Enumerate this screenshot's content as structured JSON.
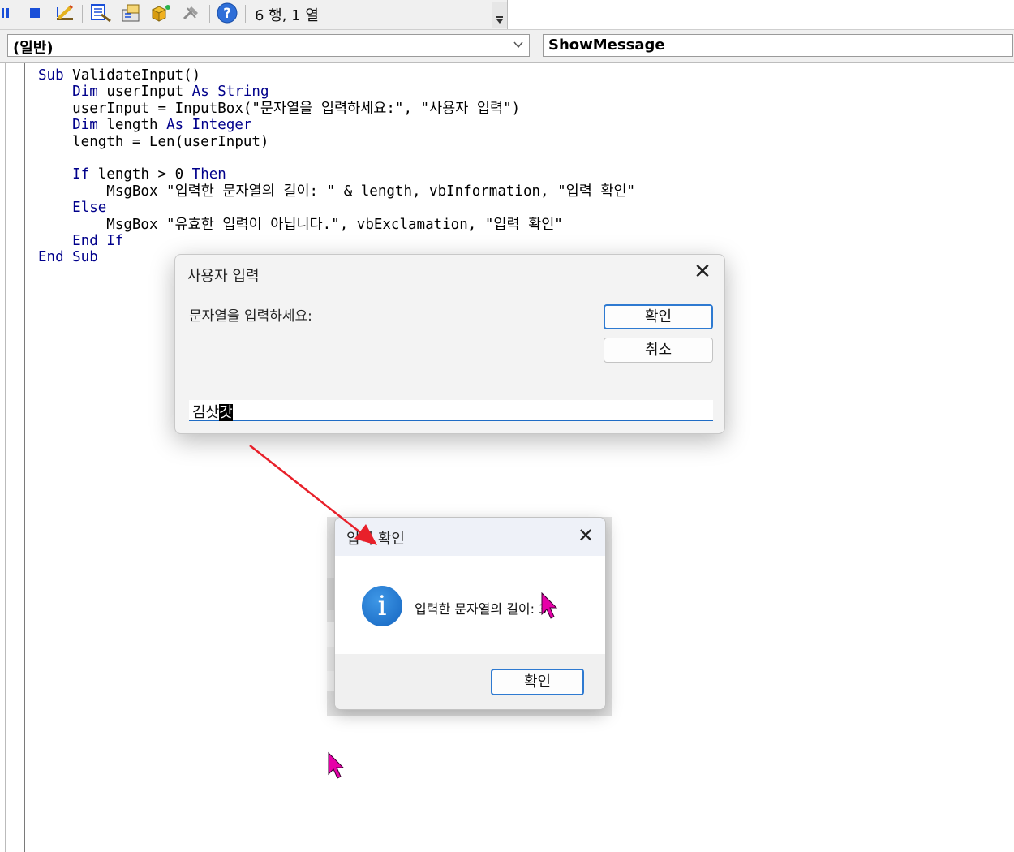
{
  "toolbar": {
    "icons": [
      "pause-icon",
      "stop-icon",
      "design-mode-icon",
      "project-explorer-icon",
      "properties-icon",
      "object-browser-icon",
      "toolbox-icon",
      "help-icon"
    ],
    "cursor_position": "6 행, 1 열"
  },
  "combo": {
    "object": "(일반)",
    "procedure": "ShowMessage"
  },
  "code": {
    "lines": [
      [
        {
          "t": "Sub ",
          "k": true
        },
        {
          "t": "ValidateInput()",
          "k": false
        }
      ],
      [
        {
          "t": "    ",
          "k": false
        },
        {
          "t": "Dim ",
          "k": true
        },
        {
          "t": "userInput ",
          "k": false
        },
        {
          "t": "As String",
          "k": true
        }
      ],
      [
        {
          "t": "    userInput = InputBox(\"문자열을 입력하세요:\", \"사용자 입력\")",
          "k": false
        }
      ],
      [
        {
          "t": "    ",
          "k": false
        },
        {
          "t": "Dim ",
          "k": true
        },
        {
          "t": "length ",
          "k": false
        },
        {
          "t": "As Integer",
          "k": true
        }
      ],
      [
        {
          "t": "    length = Len(userInput)",
          "k": false
        }
      ],
      [],
      [
        {
          "t": "    ",
          "k": false
        },
        {
          "t": "If ",
          "k": true
        },
        {
          "t": "length > 0 ",
          "k": false
        },
        {
          "t": "Then",
          "k": true
        }
      ],
      [
        {
          "t": "        MsgBox \"입력한 문자열의 길이: \" & length, vbInformation, \"입력 확인\"",
          "k": false
        }
      ],
      [
        {
          "t": "    ",
          "k": false
        },
        {
          "t": "Else",
          "k": true
        }
      ],
      [
        {
          "t": "        MsgBox \"유효한 입력이 아닙니다.\", vbExclamation, \"입력 확인\"",
          "k": false
        }
      ],
      [
        {
          "t": "    ",
          "k": false
        },
        {
          "t": "End If",
          "k": true
        }
      ],
      [
        {
          "t": "End Sub",
          "k": true
        }
      ]
    ]
  },
  "inputbox": {
    "title": "사용자 입력",
    "close": "✕",
    "prompt": "문자열을 입력하세요:",
    "ok_label": "확인",
    "cancel_label": "취소",
    "value_plain": "김삿",
    "value_selected": "갓"
  },
  "msgbox": {
    "title": "입력 확인",
    "close": "✕",
    "icon": "info-icon",
    "message": "입력한 문자열의 길이: 3",
    "ok_label": "확인"
  },
  "colors": {
    "keyword": "#00008b",
    "arrow": "#e8202a",
    "cursor": "#e600a8",
    "accent": "#1f6cc5"
  }
}
